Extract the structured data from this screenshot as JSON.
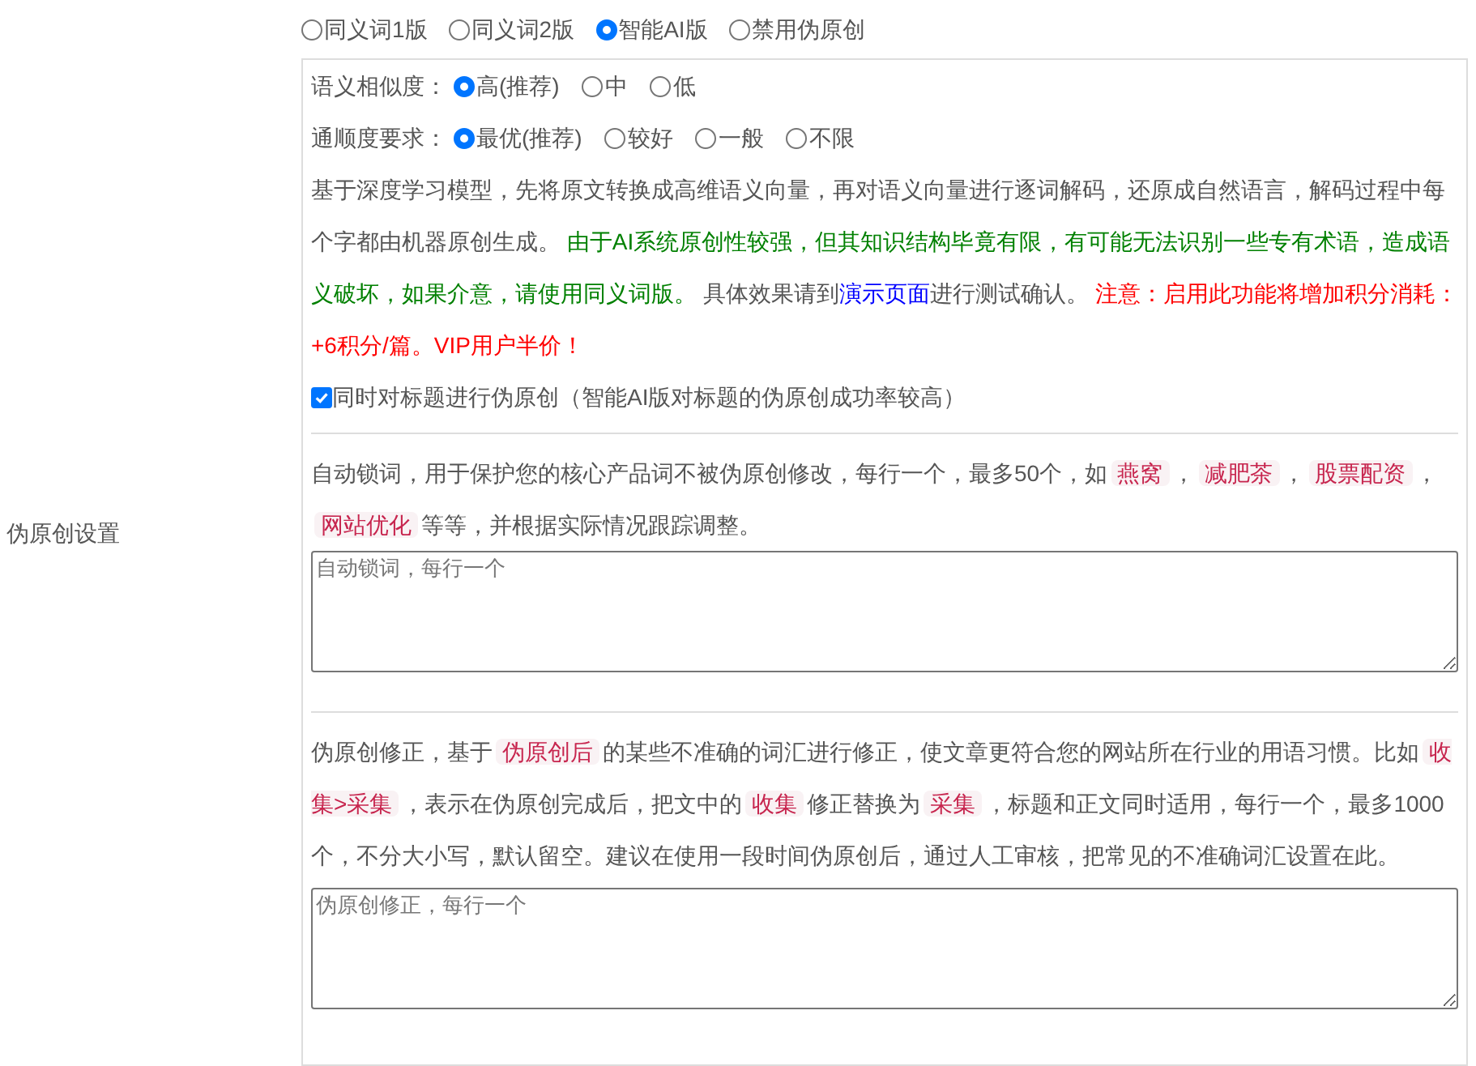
{
  "sidebar_label": "伪原创设置",
  "modes": [
    {
      "label": "同义词1版",
      "selected": false
    },
    {
      "label": "同义词2版",
      "selected": false
    },
    {
      "label": "智能AI版",
      "selected": true
    },
    {
      "label": "禁用伪原创",
      "selected": false
    }
  ],
  "settings": [
    {
      "label": "语义相似度：",
      "options": [
        {
          "label": "高(推荐)",
          "selected": true
        },
        {
          "label": "中",
          "selected": false
        },
        {
          "label": "低",
          "selected": false
        }
      ]
    },
    {
      "label": "通顺度要求：",
      "options": [
        {
          "label": "最优(推荐)",
          "selected": true
        },
        {
          "label": "较好",
          "selected": false
        },
        {
          "label": "一般",
          "selected": false
        },
        {
          "label": "不限",
          "selected": false
        }
      ]
    }
  ],
  "description": [
    {
      "kind": "plain",
      "text": "基于深度学习模型，先将原文转换成高维语义向量，再对语义向量进行逐词解码，还原成自然语言，解码过程中每个字都由机器原创生成。 "
    },
    {
      "kind": "green",
      "text": "由于AI系统原创性较强，但其知识结构毕竟有限，有可能无法识别一些专有术语，造成语义破坏，如果介意，请使用同义词版。"
    },
    {
      "kind": "plain",
      "text": " 具体效果请到"
    },
    {
      "kind": "link",
      "text": "演示页面"
    },
    {
      "kind": "plain",
      "text": "进行测试确认。 "
    },
    {
      "kind": "red",
      "text": "注意：启用此功能将增加积分消耗：+6积分/篇。VIP用户半价！"
    }
  ],
  "title_option": {
    "label": "同时对标题进行伪原创（智能AI版对标题的伪原创成功率较高）",
    "checked": true
  },
  "lock_words": {
    "segments": [
      {
        "kind": "plain",
        "text": "自动锁词，用于保护您的核心产品词不被伪原创修改，每行一个，最多50个，如"
      },
      {
        "kind": "tag",
        "text": "燕窝"
      },
      {
        "kind": "plain",
        "text": "，"
      },
      {
        "kind": "tag",
        "text": "减肥茶"
      },
      {
        "kind": "plain",
        "text": "，"
      },
      {
        "kind": "tag",
        "text": "股票配资"
      },
      {
        "kind": "plain",
        "text": "，"
      },
      {
        "kind": "tag",
        "text": "网站优化"
      },
      {
        "kind": "plain",
        "text": "等等，并根据实际情况跟踪调整。"
      }
    ],
    "placeholder": "自动锁词，每行一个"
  },
  "correction": {
    "segments": [
      {
        "kind": "plain",
        "text": "伪原创修正，基于"
      },
      {
        "kind": "tag",
        "text": "伪原创后"
      },
      {
        "kind": "plain",
        "text": "的某些不准确的词汇进行修正，使文章更符合您的网站所在行业的用语习惯。比如"
      },
      {
        "kind": "tag",
        "text": "收集>采集"
      },
      {
        "kind": "plain",
        "text": "，表示在伪原创完成后，把文中的"
      },
      {
        "kind": "tag",
        "text": "收集"
      },
      {
        "kind": "plain",
        "text": "修正替换为"
      },
      {
        "kind": "tag",
        "text": "采集"
      },
      {
        "kind": "plain",
        "text": "，标题和正文同时适用，每行一个，最多1000个，不分大小写，默认留空。建议在使用一段时间伪原创后，通过人工审核，把常见的不准确词汇设置在此。"
      }
    ],
    "placeholder": "伪原创修正，每行一个"
  }
}
